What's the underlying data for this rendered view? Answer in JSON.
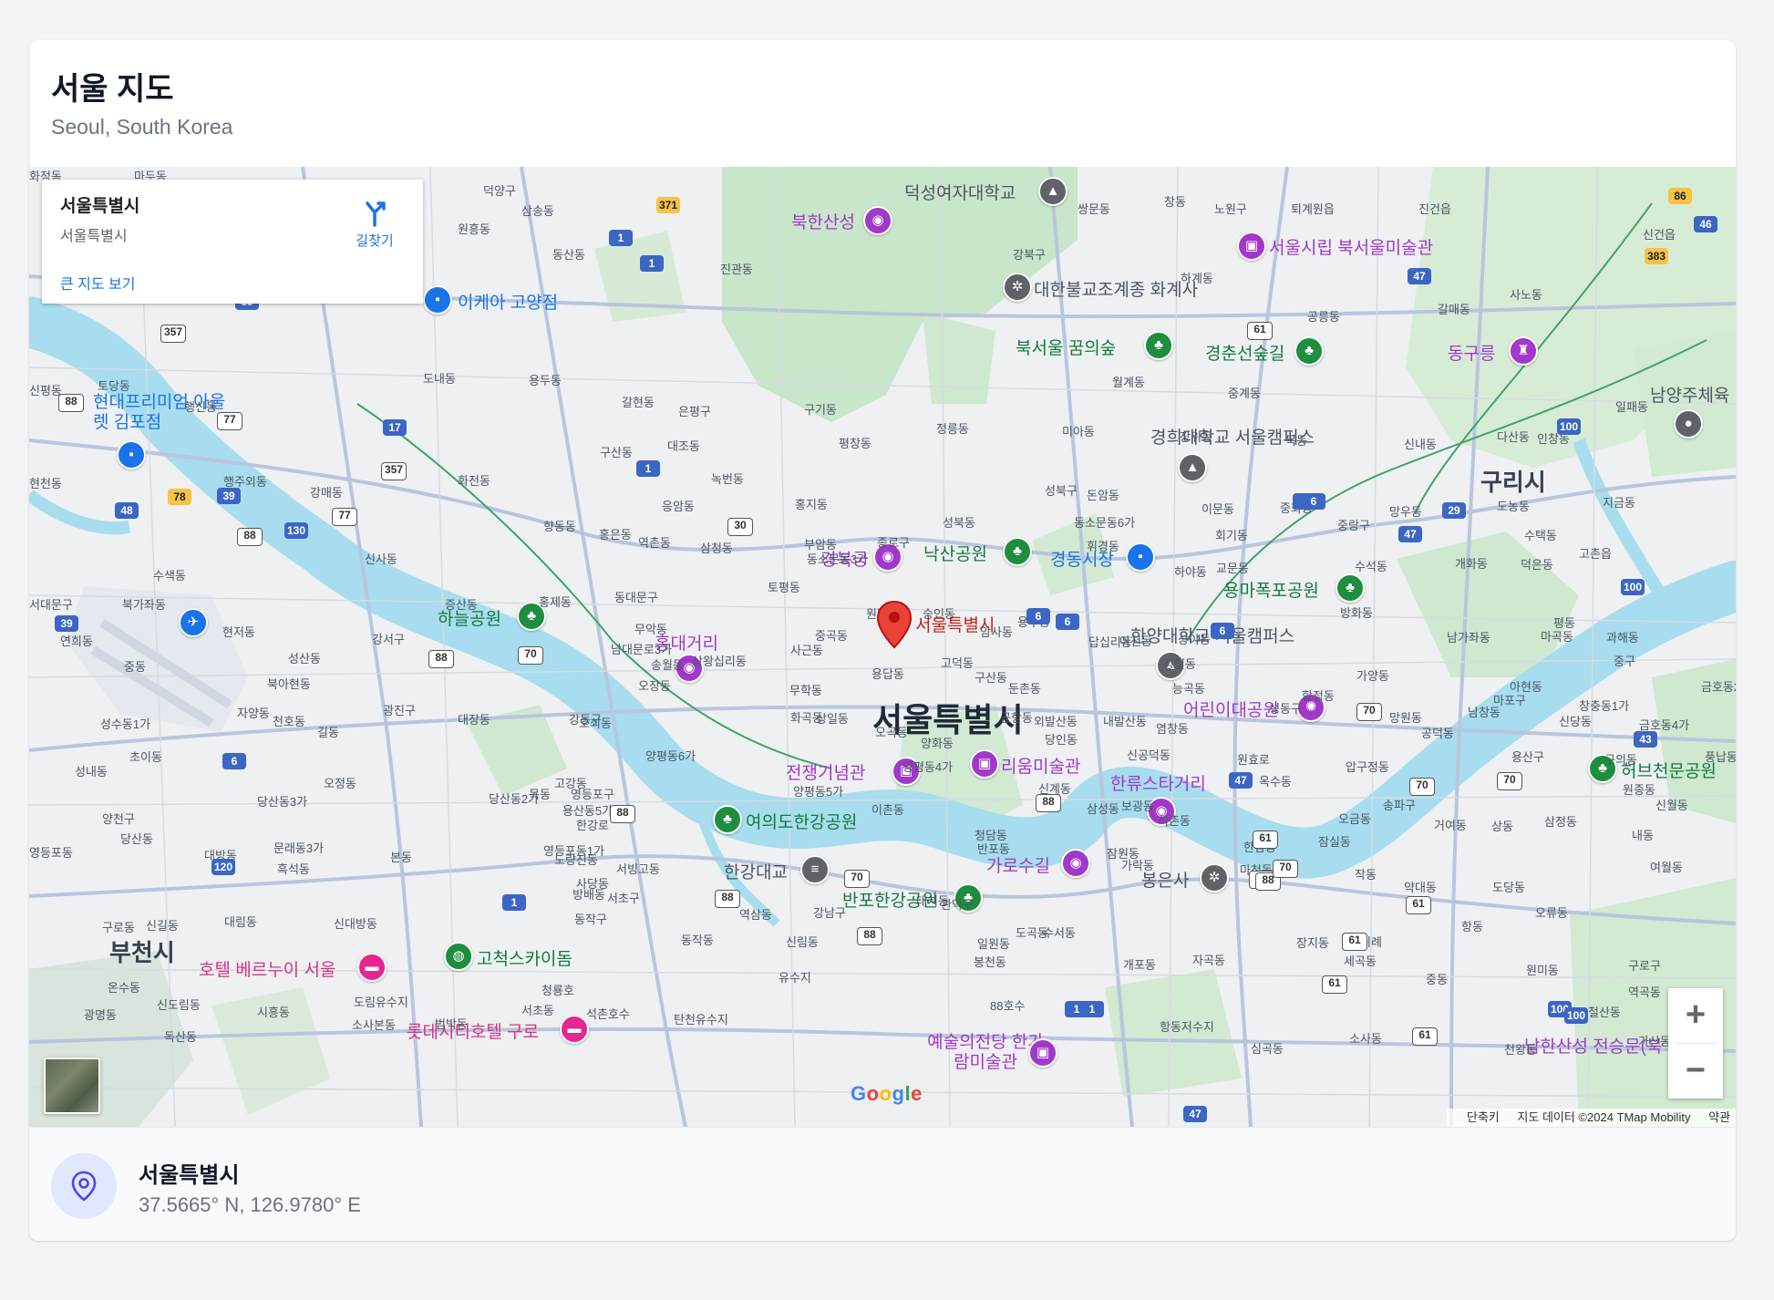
{
  "header": {
    "title": "서울 지도",
    "subtitle": "Seoul, South Korea"
  },
  "info_window": {
    "title": "서울특별시",
    "address": "서울특별시",
    "directions_label": "길찾기",
    "larger_map_link": "큰 지도 보기"
  },
  "map": {
    "marker_label": "서울특별시",
    "city_label": "서울특별시",
    "cities": {
      "bucheon": "부천시",
      "guri": "구리시"
    },
    "pois": [
      {
        "name": "북한산성",
        "color": "purple",
        "icon": "camera"
      },
      {
        "name": "덕성여자대학교",
        "color": "gray",
        "icon": "school"
      },
      {
        "name": "서울시립 북서울미술관",
        "color": "purple",
        "icon": "museum"
      },
      {
        "name": "대한불교조계종 화계사",
        "color": "gray",
        "icon": "temple"
      },
      {
        "name": "이케아 고양점",
        "color": "blue",
        "icon": "shopping"
      },
      {
        "name": "북서울 꿈의숲",
        "color": "green",
        "icon": "park"
      },
      {
        "name": "경춘선숲길",
        "color": "green",
        "icon": "park"
      },
      {
        "name": "동구릉",
        "color": "purple",
        "icon": "landmark"
      },
      {
        "name": "현대프리미엄 아울렛 김포점",
        "color": "blue",
        "icon": "shopping"
      },
      {
        "name": "경희대학교 서울캠퍼스",
        "color": "gray",
        "icon": "school"
      },
      {
        "name": "남양주체육",
        "color": "gray",
        "icon": "pin"
      },
      {
        "name": "경복궁",
        "color": "purple",
        "icon": "camera"
      },
      {
        "name": "낙산공원",
        "color": "green",
        "icon": "park"
      },
      {
        "name": "경동시장",
        "color": "blue",
        "icon": "shopping"
      },
      {
        "name": "용마폭포공원",
        "color": "green",
        "icon": "park"
      },
      {
        "name": "하늘공원",
        "color": "green",
        "icon": "park"
      },
      {
        "name": "홍대거리",
        "color": "purple",
        "icon": "camera"
      },
      {
        "name": "한양대학교 서울캠퍼스",
        "color": "gray",
        "icon": "school"
      },
      {
        "name": "어린이대공원",
        "color": "purple",
        "icon": "attraction"
      },
      {
        "name": "전쟁기념관",
        "color": "purple",
        "icon": "museum"
      },
      {
        "name": "리움미술관",
        "color": "purple",
        "icon": "museum"
      },
      {
        "name": "한류스타거리",
        "color": "purple",
        "icon": "camera"
      },
      {
        "name": "허브천문공원",
        "color": "green",
        "icon": "park"
      },
      {
        "name": "여의도한강공원",
        "color": "green",
        "icon": "park"
      },
      {
        "name": "한강대교",
        "color": "gray",
        "icon": "bridge"
      },
      {
        "name": "가로수길",
        "color": "purple",
        "icon": "camera"
      },
      {
        "name": "봉은사",
        "color": "gray",
        "icon": "temple"
      },
      {
        "name": "반포한강공원",
        "color": "green",
        "icon": "park"
      },
      {
        "name": "고척스카이돔",
        "color": "green",
        "icon": "stadium"
      },
      {
        "name": "호텔 베르누이 서울",
        "color": "pink",
        "icon": "hotel"
      },
      {
        "name": "롯데시티호텔 구로",
        "color": "pink",
        "icon": "hotel"
      },
      {
        "name": "예술의전당 한가람미술관",
        "color": "purple",
        "icon": "museum"
      },
      {
        "name": "남한산성 전승문(북",
        "color": "purple",
        "icon": "landmark"
      }
    ],
    "areas": [
      "마두동",
      "덕양구",
      "삼송동",
      "원흥동",
      "동산동",
      "진관동",
      "쌍문동",
      "노원구",
      "창동",
      "퇴계원읍",
      "진건읍",
      "신건읍",
      "강북구",
      "하계동",
      "공릉동",
      "갈매동",
      "사노동",
      "화정동",
      "도내동",
      "용두동",
      "갈현동",
      "은평구",
      "구기동",
      "월계동",
      "중계동",
      "신평동",
      "토당동",
      "행신동",
      "대조동",
      "평창동",
      "정릉동",
      "미아동",
      "장위동",
      "묵동",
      "신내동",
      "다산동",
      "일패동",
      "인창동",
      "구산동",
      "녹번동",
      "홍지동",
      "성북구",
      "돈암동",
      "이문동",
      "중화동",
      "망우동",
      "도농동",
      "지금동",
      "행주외동",
      "강매동",
      "화전동",
      "향동동",
      "역촌동",
      "응암동",
      "부암동",
      "종로구",
      "성북동",
      "동소문동6가",
      "회기동",
      "중랑구",
      "수택동",
      "고촌읍",
      "현천동",
      "신사동",
      "홍은동",
      "삼청동",
      "동소문동3가",
      "휘경동",
      "교문동",
      "수석동",
      "개화동",
      "덕은동",
      "수색동",
      "증산동",
      "홍제동",
      "동대문구",
      "토평동",
      "하야동",
      "평동",
      "북가좌동",
      "서대문구",
      "무악동",
      "원남동",
      "숭인동",
      "용두동",
      "답십리동",
      "아천동",
      "상야동",
      "방화동",
      "남가좌동",
      "연희동",
      "현저동",
      "송월동",
      "상왕십리동",
      "사근동",
      "중곡동",
      "암사동",
      "강일동",
      "가양동",
      "마곡동",
      "과해동",
      "강서구",
      "성산동",
      "중동",
      "북아현동",
      "남대문로3가",
      "오장동",
      "무학동",
      "용답동",
      "고덕동",
      "구산동",
      "둔촌동",
      "능곡동",
      "마포구",
      "망원동",
      "아현동",
      "남창동",
      "중구",
      "창충동1가",
      "신당동",
      "금호동2가",
      "성동구",
      "광진구",
      "강동구",
      "상일동",
      "오곡동",
      "공항동",
      "외발산동",
      "내발산동",
      "염창동",
      "합정동",
      "공덕동",
      "용산구",
      "금호동4가",
      "성수동1가",
      "자양동",
      "천호동",
      "길동",
      "대장동",
      "오쇠동",
      "화곡동",
      "양화동",
      "당인동",
      "신공덕동",
      "원효로",
      "옥수동",
      "압구정동",
      "구의동",
      "풍납동",
      "성내동",
      "초이동",
      "오정동",
      "고강동",
      "목동",
      "양평동6가",
      "양평동5가",
      "양평동4가",
      "신계동",
      "보광동",
      "한남동",
      "잠실동",
      "송파구",
      "거여동",
      "원종동",
      "신월동",
      "양천구",
      "당산동3가",
      "당산동2가",
      "영등포구",
      "용산동5가",
      "한강로",
      "이촌동",
      "청담동",
      "삼성동",
      "석촌동",
      "오금동",
      "상동",
      "삼정동",
      "내동",
      "당산동",
      "문래동3가",
      "영등포동1가",
      "노량진동",
      "본동",
      "서빙고동",
      "반포동",
      "잠원동",
      "가락동",
      "마천동",
      "작동",
      "약대동",
      "도당동",
      "여월동",
      "영등포동",
      "대방동",
      "흑석동",
      "사당동",
      "방배동",
      "서초구",
      "역삼동",
      "강남구",
      "대치동",
      "일원동",
      "수서동",
      "장지동",
      "위례",
      "항동",
      "오류동",
      "구로구",
      "구로동",
      "신길동",
      "대림동",
      "신대방동",
      "동작구",
      "동작동",
      "신림동",
      "관악구",
      "봉천동",
      "도곡동",
      "개포동",
      "자곡동",
      "세곡동",
      "중동",
      "원미동",
      "역곡동",
      "온수동",
      "신도림동",
      "도림유수지",
      "청룡호",
      "석촌호수",
      "탄천유수지",
      "유수지",
      "88호수",
      "항동저수지",
      "심곡동",
      "소사동",
      "천왕동",
      "철산동",
      "가산동",
      "광명동",
      "독산동",
      "시흥동",
      "소사본동",
      "범박동",
      "서초동"
    ],
    "roads": [
      "371",
      "1",
      "1",
      "39",
      "357",
      "88",
      "77",
      "17",
      "357",
      "78",
      "39",
      "48",
      "130",
      "77",
      "88",
      "30",
      "1",
      "6",
      "6",
      "88",
      "70",
      "39",
      "6",
      "120",
      "88",
      "1",
      "88",
      "70",
      "88",
      "88",
      "70",
      "61",
      "88",
      "47",
      "6",
      "29",
      "100",
      "100",
      "47",
      "61",
      "86",
      "46",
      "383",
      "47",
      "61",
      "88",
      "43",
      "70",
      "70",
      "61",
      "1",
      "47",
      "61",
      "100",
      "61",
      "1",
      "100",
      "70",
      "6",
      "6"
    ],
    "zoom_in_label": "+",
    "zoom_out_label": "−",
    "google_letters": [
      "G",
      "o",
      "o",
      "g",
      "l",
      "e"
    ],
    "google_colors": [
      "#4285F4",
      "#EA4335",
      "#FBBC05",
      "#4285F4",
      "#34A853",
      "#EA4335"
    ],
    "attribution": {
      "shortcuts": "단축키",
      "map_data": "지도 데이터 ©2024 TMap Mobility",
      "terms": "약관"
    }
  },
  "footer": {
    "name": "서울특별시",
    "coords": "37.5665° N, 126.9780° E"
  }
}
